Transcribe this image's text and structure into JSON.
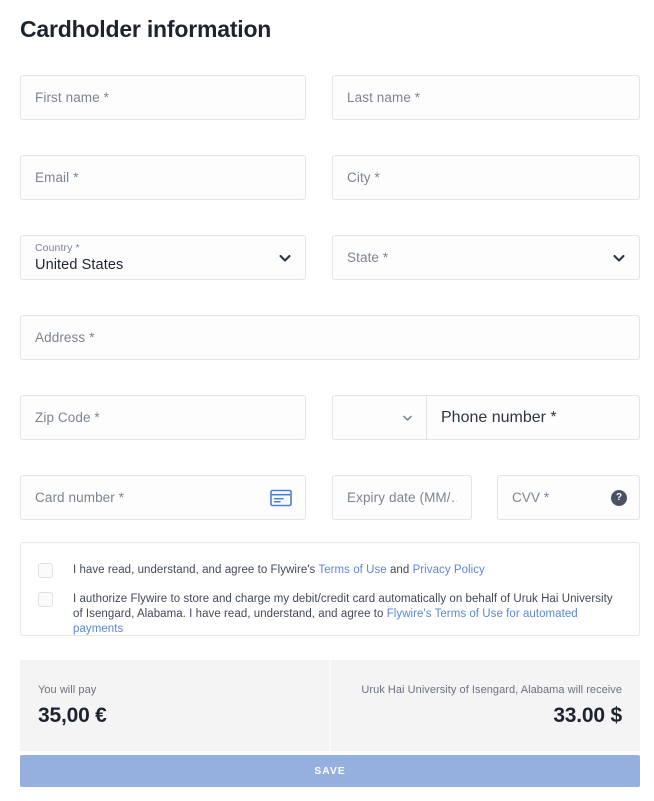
{
  "page": {
    "title": "Cardholder information"
  },
  "fields": {
    "first_name": {
      "placeholder": "First name *"
    },
    "last_name": {
      "placeholder": "Last name *"
    },
    "email": {
      "placeholder": "Email *"
    },
    "city": {
      "placeholder": "City *"
    },
    "country": {
      "label": "Country *",
      "value": "United States"
    },
    "state": {
      "placeholder": "State *"
    },
    "address": {
      "placeholder": "Address *"
    },
    "zip_code": {
      "placeholder": "Zip Code *"
    },
    "phone_country_code": {
      "value": ""
    },
    "phone_number": {
      "placeholder": "Phone number *"
    },
    "card_number": {
      "placeholder": "Card number *"
    },
    "expiry_date": {
      "placeholder": "Expiry date (MM/…"
    },
    "cvv": {
      "placeholder": "CVV *"
    }
  },
  "icons": {
    "chevron_down": "chevron-down-icon",
    "credit_card": "credit-card-icon",
    "help": "help-icon",
    "help_glyph": "?"
  },
  "terms": {
    "consent": {
      "text_before": "I have read, understand, and agree to Flywire's ",
      "link1": "Terms of Use",
      "text_middle": " and ",
      "link2": "Privacy Policy"
    },
    "authorization": {
      "text_before": "I authorize Flywire to store and charge my debit/credit card automatically on behalf of Uruk Hai University of Isengard, Alabama. I have read, understand, and agree to ",
      "link": "Flywire's Terms of Use for automated payments"
    }
  },
  "summary": {
    "pay_label": "You will pay",
    "pay_amount": "35,00 €",
    "receive_label": "Uruk Hai University of Isengard, Alabama will receive",
    "receive_amount": "33.00 $"
  },
  "actions": {
    "save_label": "SAVE"
  },
  "colors": {
    "accent_link": "#5b87d8",
    "card_icon": "#4a7fd4",
    "save_button": "#95b0de",
    "help_badge": "#4a5264",
    "summary_bg": "#f4f4f5",
    "field_border": "#e4e4e8",
    "text_dark": "#1d2430",
    "text_muted": "#7b8494"
  }
}
